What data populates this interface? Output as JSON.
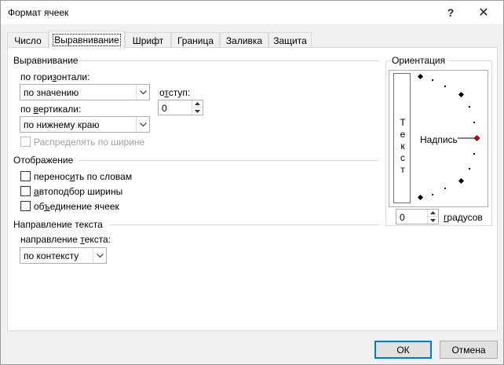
{
  "window": {
    "title": "Формат ячеек",
    "help_symbol": "?",
    "close_symbol": "✕"
  },
  "tabs": [
    {
      "label": "Число",
      "active": false
    },
    {
      "label": "Выравнивание",
      "active": true
    },
    {
      "label": "Шрифт",
      "active": false
    },
    {
      "label": "Граница",
      "active": false
    },
    {
      "label": "Заливка",
      "active": false
    },
    {
      "label": "Защита",
      "active": false
    }
  ],
  "alignment": {
    "group_title": "Выравнивание",
    "horizontal": {
      "label_pre": "по гори",
      "label_u": "з",
      "label_post": "онтали:",
      "value": "по значению"
    },
    "indent": {
      "label_pre": "о",
      "label_u": "т",
      "label_post": "ступ:",
      "value": "0"
    },
    "vertical": {
      "label_pre": "по ",
      "label_u": "в",
      "label_post": "ертикали:",
      "value": "по нижнему краю"
    },
    "distributed": {
      "label": "Распределять по ширине",
      "checked": false,
      "enabled": false
    }
  },
  "display": {
    "group_title": "Отображение",
    "wrap": {
      "label_pre": "перенос",
      "label_u": "и",
      "label_post": "ть по словам",
      "checked": false
    },
    "shrink": {
      "label_pre": "",
      "label_u": "а",
      "label_post": "втоподбор ширины",
      "checked": false
    },
    "merge": {
      "label_pre": "об",
      "label_u": "ъ",
      "label_post": "единение ячеек",
      "checked": false
    }
  },
  "direction": {
    "group_title": "Направление текста",
    "label_pre": "направление ",
    "label_u": "т",
    "label_post": "екста:",
    "value": "по контексту"
  },
  "orientation": {
    "group_title": "Ориентация",
    "vertical_text": [
      "Т",
      "е",
      "к",
      "с",
      "т"
    ],
    "label_text": "Надпись",
    "degrees_value": "0",
    "degrees_label_pre": "",
    "degrees_label_u": "г",
    "degrees_label_post": "радусов",
    "angle_degrees": 0
  },
  "buttons": {
    "ok": "ОК",
    "cancel": "Отмена"
  },
  "colors": {
    "accent": "#0078d7",
    "marker": "#c00000"
  }
}
